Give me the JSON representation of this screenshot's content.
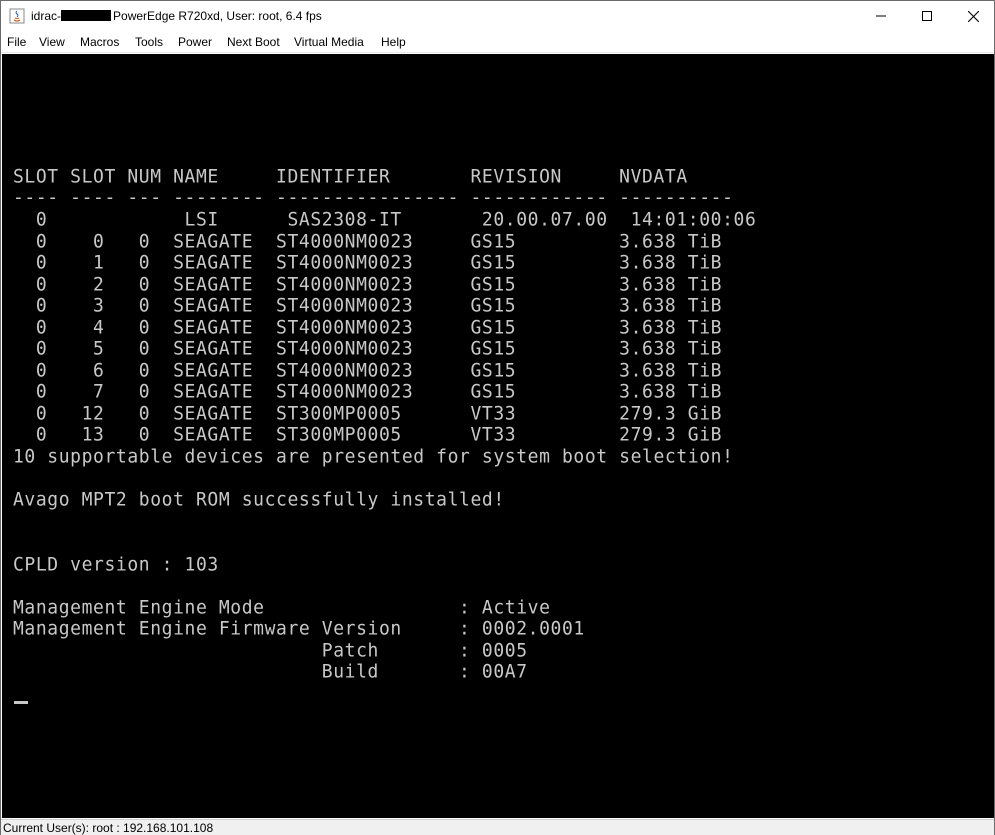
{
  "window": {
    "title_prefix": "idrac-",
    "title_suffix": "PowerEdge R720xd, User: root, 6.4 fps"
  },
  "menu": [
    "File",
    "View",
    "Macros",
    "Tools",
    "Power",
    "Next Boot",
    "Virtual Media",
    "Help"
  ],
  "console": {
    "lines": [
      "SLOT SLOT NUM NAME     IDENTIFIER       REVISION     NVDATA",
      "---- ---- --- -------- ---------------- ------------ ----------",
      "  0            LSI      SAS2308-IT       20.00.07.00  14:01:00:06",
      "  0    0   0  SEAGATE  ST4000NM0023     GS15         3.638 TiB",
      "  0    1   0  SEAGATE  ST4000NM0023     GS15         3.638 TiB",
      "  0    2   0  SEAGATE  ST4000NM0023     GS15         3.638 TiB",
      "  0    3   0  SEAGATE  ST4000NM0023     GS15         3.638 TiB",
      "  0    4   0  SEAGATE  ST4000NM0023     GS15         3.638 TiB",
      "  0    5   0  SEAGATE  ST4000NM0023     GS15         3.638 TiB",
      "  0    6   0  SEAGATE  ST4000NM0023     GS15         3.638 TiB",
      "  0    7   0  SEAGATE  ST4000NM0023     GS15         3.638 TiB",
      "  0   12   0  SEAGATE  ST300MP0005      VT33         279.3 GiB",
      "  0   13   0  SEAGATE  ST300MP0005      VT33         279.3 GiB",
      "10 supportable devices are presented for system boot selection!",
      "",
      "Avago MPT2 boot ROM successfully installed!",
      "",
      "",
      "CPLD version : 103",
      "",
      "Management Engine Mode                 : Active",
      "Management Engine Firmware Version     : 0002.0001",
      "                           Patch       : 0005",
      "                           Build       : 00A7"
    ]
  },
  "status": {
    "text": "Current User(s): root : 192.168.101.108"
  },
  "colors": {
    "console_bg": "#000000",
    "console_fg": "#c8c8c8"
  }
}
